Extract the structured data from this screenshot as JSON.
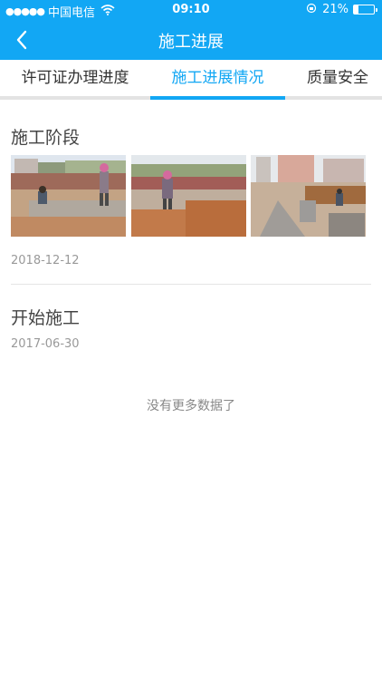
{
  "status_bar": {
    "signal_dots": "●●●●●",
    "carrier": "中国电信",
    "wifi_icon": "wifi-icon",
    "time": "09:10",
    "battery_percent": "21%",
    "battery_level": 0.21
  },
  "nav": {
    "title": "施工进展",
    "back_icon": "chevron-left-icon"
  },
  "tabs": [
    {
      "label": "许可证办理进度",
      "active": false
    },
    {
      "label": "施工进展情况",
      "active": true
    },
    {
      "label": "质量安全",
      "active": false
    }
  ],
  "entries": [
    {
      "title": "施工阶段",
      "date": "2018-12-12",
      "photos": [
        "construction-photo-1",
        "construction-photo-2",
        "construction-photo-3"
      ]
    },
    {
      "title": "开始施工",
      "date": "2017-06-30",
      "photos": []
    }
  ],
  "footer": {
    "no_more": "没有更多数据了"
  },
  "colors": {
    "accent": "#12a7f4",
    "divider": "#e5e5e5",
    "muted_text": "#999999"
  }
}
